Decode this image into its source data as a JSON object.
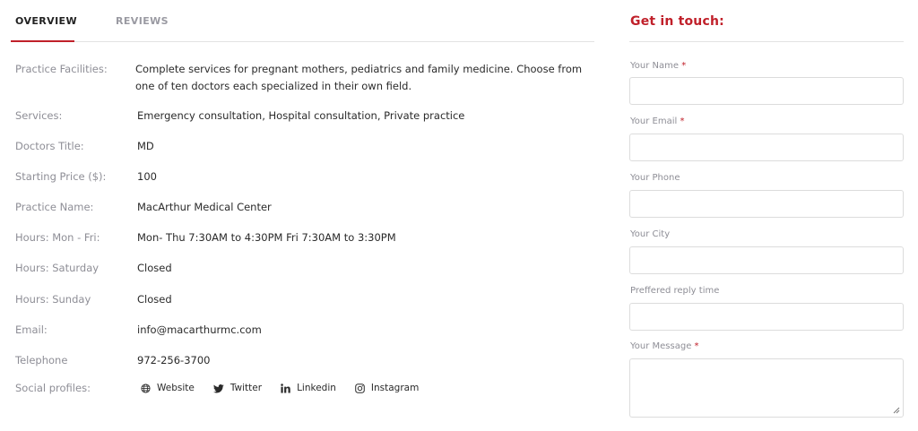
{
  "tabs": {
    "overview": "OVERVIEW",
    "reviews": "REVIEWS"
  },
  "details": [
    {
      "label": "Practice Facilities:",
      "value": "Complete services for pregnant mothers, pediatrics and family medicine. Choose from one of ten doctors each specialized in their own field."
    },
    {
      "label": "Services:",
      "value": "Emergency consultation, Hospital consultation, Private practice"
    },
    {
      "label": "Doctors Title:",
      "value": "MD"
    },
    {
      "label": "Starting Price ($):",
      "value": "100"
    },
    {
      "label": "Practice Name:",
      "value": "MacArthur Medical Center"
    },
    {
      "label": "Hours: Mon - Fri:",
      "value": "Mon- Thu 7:30AM to 4:30PM Fri 7:30AM to 3:30PM"
    },
    {
      "label": "Hours: Saturday",
      "value": "Closed"
    },
    {
      "label": "Hours: Sunday",
      "value": "Closed"
    },
    {
      "label": "Email:",
      "value": "info@macarthurmc.com"
    },
    {
      "label": "Telephone",
      "value": "972-256-3700"
    }
  ],
  "social": {
    "label": "Social profiles:",
    "links": [
      {
        "label": "Website",
        "icon": "globe-icon"
      },
      {
        "label": "Twitter",
        "icon": "twitter-icon"
      },
      {
        "label": "Linkedin",
        "icon": "linkedin-icon"
      },
      {
        "label": "Instagram",
        "icon": "instagram-icon"
      }
    ]
  },
  "contact": {
    "title": "Get in touch:",
    "required_mark": "*",
    "fields": {
      "name": "Your Name",
      "email": "Your Email",
      "phone": "Your Phone",
      "city": "Your City",
      "reply_time": "Preffered reply time",
      "message": "Your Message"
    }
  },
  "colors": {
    "accent": "#c0202a",
    "label": "#8e8e96",
    "text": "#2a2a2a",
    "border": "#dcdcdc"
  }
}
